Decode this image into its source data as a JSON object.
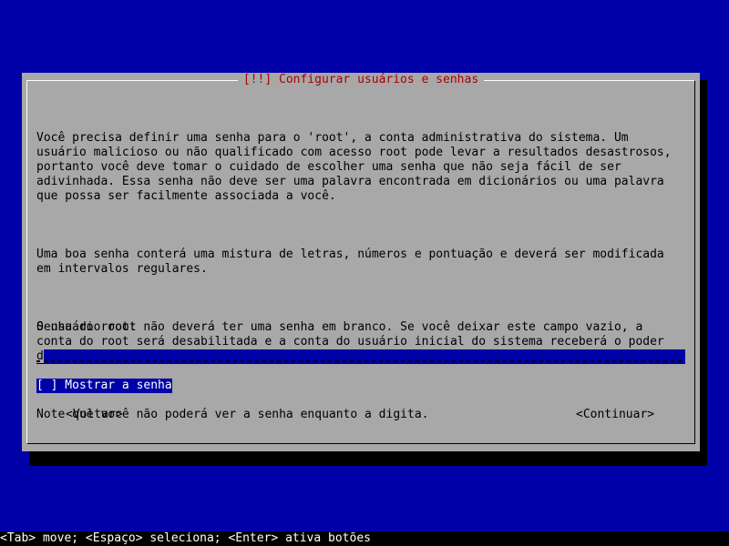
{
  "dialog": {
    "title": "[!!] Configurar usuários e senhas",
    "paragraphs": [
      "Você precisa definir uma senha para o 'root', a conta administrativa do sistema. Um\nusuário malicioso ou não qualificado com acesso root pode levar a resultados desastrosos,\nportanto você deve tomar o cuidado de escolher uma senha que não seja fácil de ser\nadivinhada. Essa senha não deve ser uma palavra encontrada em dicionários ou uma palavra\nque possa ser facilmente associada a você.",
      "Uma boa senha conterá uma mistura de letras, números e pontuação e deverá ser modificada\nem intervalos regulares.",
      "O usuário root não deverá ter uma senha em branco. Se você deixar este campo vazio, a\nconta do root será desabilitada e a conta do usuário inicial do sistema receberá o poder\nde tornar-se root usando o comando \"sudo\".",
      "Note que você não poderá ver a senha enquanto a digita."
    ],
    "password_label": "Senha do root:",
    "password_value": "",
    "show_password_label": "[ ] Mostrar a senha",
    "back_button": "<Voltar>",
    "continue_button": "<Continuar>"
  },
  "statusbar": {
    "text": "<Tab> move; <Espaço> seleciona; <Enter> ativa botões"
  },
  "colors": {
    "background": "#0000a8",
    "dialog": "#a8a8a8",
    "title_text": "#a80000",
    "focus": "#0000a8"
  }
}
